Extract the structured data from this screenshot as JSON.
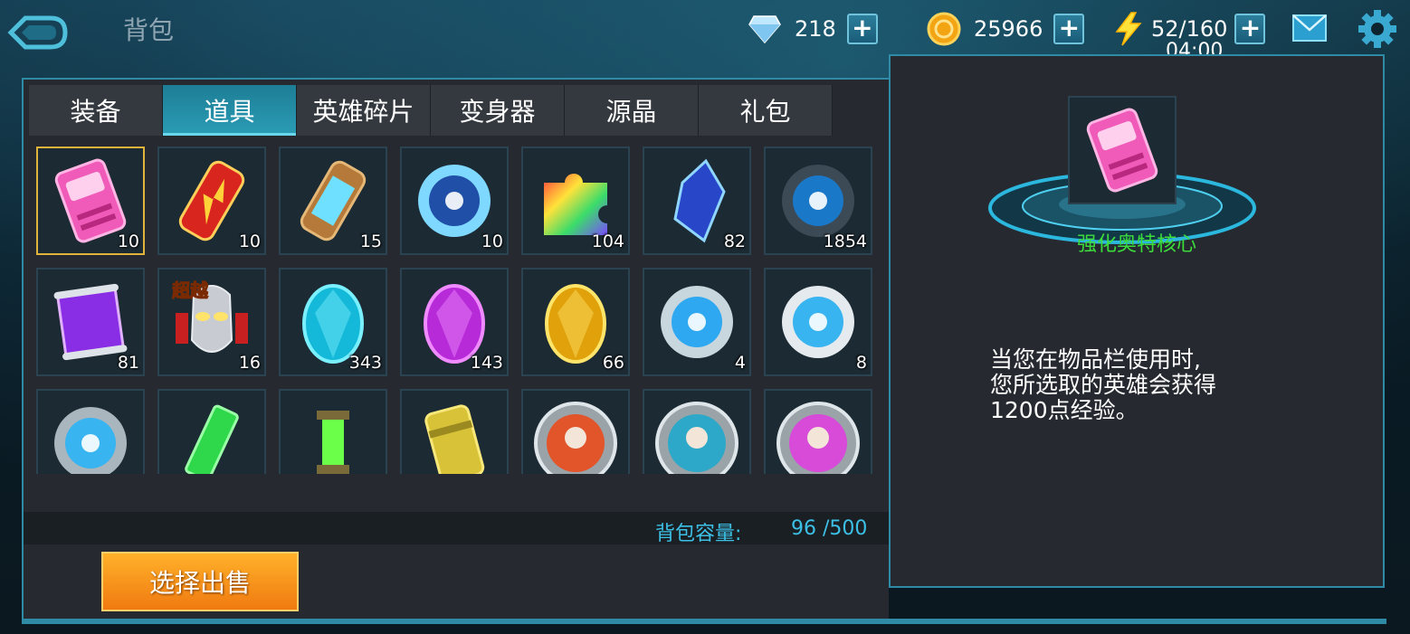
{
  "header": {
    "title": "背包",
    "diamonds": "218",
    "gold": "25966",
    "energy": "52/160",
    "energy_timer": "04:00"
  },
  "tabs": [
    {
      "label": "装备",
      "active": false
    },
    {
      "label": "道具",
      "active": true
    },
    {
      "label": "英雄碎片",
      "active": false
    },
    {
      "label": "变身器",
      "active": false
    },
    {
      "label": "源晶",
      "active": false
    },
    {
      "label": "礼包",
      "active": false
    }
  ],
  "items": [
    {
      "icon": "pink-exp-card-icon",
      "count": "10",
      "selected": true
    },
    {
      "icon": "red-energy-canister-icon",
      "count": "10"
    },
    {
      "icon": "blue-energy-canister-icon",
      "count": "15"
    },
    {
      "icon": "blue-emblem-orb-icon",
      "count": "10"
    },
    {
      "icon": "rainbow-puzzle-piece-icon",
      "count": "104"
    },
    {
      "icon": "blue-crystal-shard-icon",
      "count": "82"
    },
    {
      "icon": "blue-core-sphere-icon",
      "count": "1854"
    },
    {
      "icon": "purple-scroll-icon",
      "count": "81"
    },
    {
      "icon": "ultraman-head-icon",
      "count": "16",
      "badge": "超越"
    },
    {
      "icon": "cyan-gem-icon",
      "count": "343"
    },
    {
      "icon": "purple-gem-icon",
      "count": "143"
    },
    {
      "icon": "gold-gem-icon",
      "count": "66"
    },
    {
      "icon": "blue-orb-icon",
      "count": "4"
    },
    {
      "icon": "silver-orb-icon",
      "count": "8"
    },
    {
      "icon": "silver-ring-orb-icon",
      "count": ""
    },
    {
      "icon": "green-crystal-bar-icon",
      "count": ""
    },
    {
      "icon": "green-lantern-icon",
      "count": ""
    },
    {
      "icon": "yellow-barrel-icon",
      "count": ""
    },
    {
      "icon": "fire-medal-icon",
      "count": ""
    },
    {
      "icon": "ice-medal-icon",
      "count": ""
    },
    {
      "icon": "pink-medal-icon",
      "count": ""
    }
  ],
  "capacity": {
    "label": "背包容量:",
    "value": "96  /500"
  },
  "sell_button": "选择出售",
  "detail": {
    "icon": "pink-exp-card-icon",
    "name": "强化奥特核心",
    "desc_lines": [
      "当您在物品栏使用时,",
      "您所选取的英雄会获得",
      "1200点经验。"
    ]
  },
  "colors": {
    "accent": "#2f8aa6",
    "tab_active": "#2a9db5",
    "name_green": "#3bdc3b",
    "capacity_blue": "#3cc0e6",
    "sell_orange": "#f07a10",
    "selected_border": "#e0b43a"
  }
}
